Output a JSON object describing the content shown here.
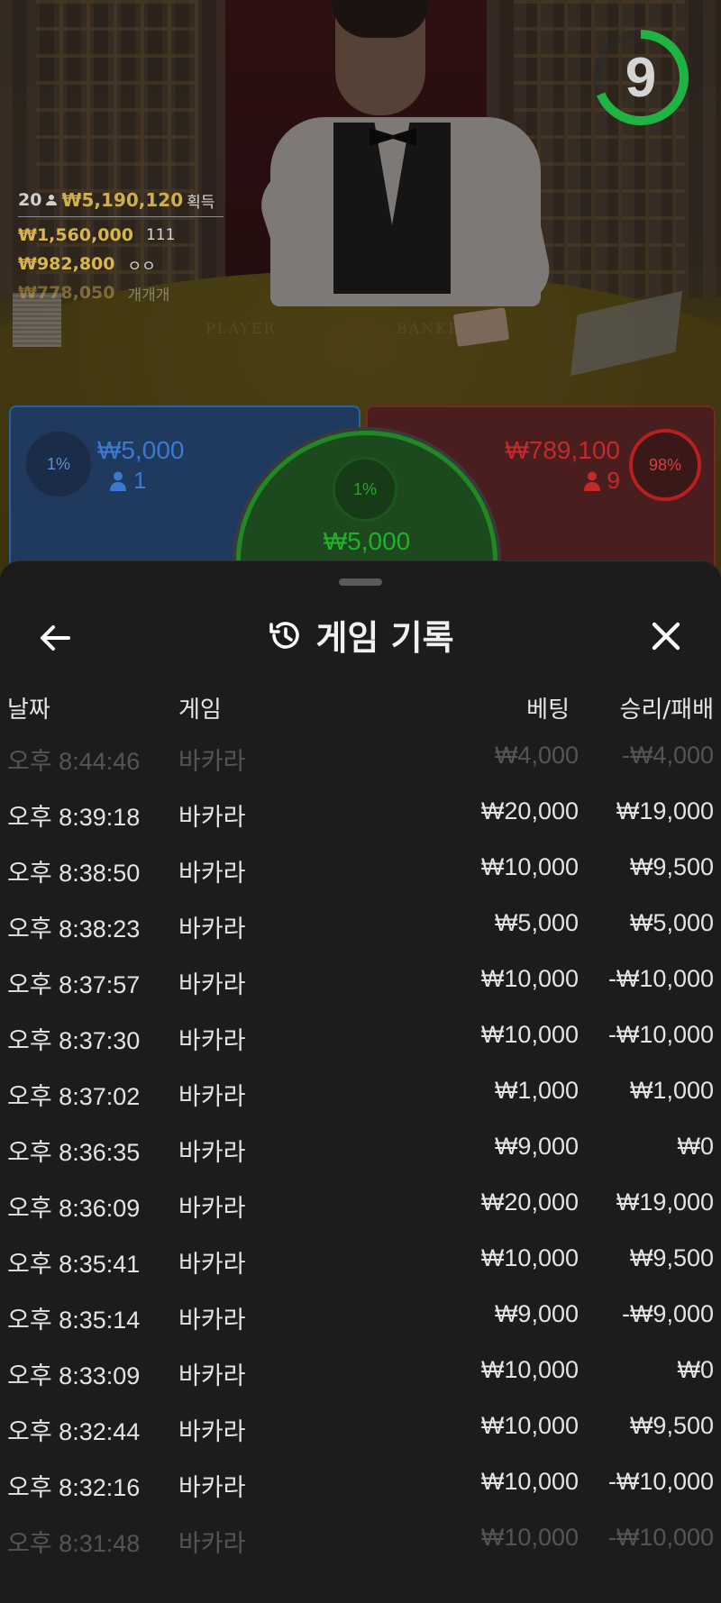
{
  "live": {
    "timer": "9",
    "felt_left": "PLAYER",
    "felt_right": "BANKER",
    "stats": {
      "player_count": "20",
      "total_won": "₩5,190,120",
      "won_label": "획득",
      "winners": [
        {
          "amount": "₩1,560,000",
          "name": "111"
        },
        {
          "amount": "₩982,800",
          "name": "ㅇㅇ"
        },
        {
          "amount": "₩778,050",
          "name": "개개개"
        }
      ]
    },
    "player_bet": {
      "percent": "1%",
      "amount": "₩5,000",
      "players": "1"
    },
    "banker_bet": {
      "percent": "98%",
      "amount": "₩789,100",
      "players": "9"
    },
    "tie_bet": {
      "percent": "1%",
      "amount": "₩5,000"
    },
    "colors": {
      "player": "#3c7ad0",
      "banker": "#c42a2a",
      "tie": "#21b02a",
      "timer_ring": "#1fb343"
    }
  },
  "sheet": {
    "title": "게임 기록",
    "title_icon": "history-icon",
    "back_icon": "arrow-left-icon",
    "close_icon": "close-icon",
    "columns": {
      "date": "날짜",
      "game": "게임",
      "bet": "베팅",
      "win_loss": "승리/패배"
    },
    "rows": [
      {
        "time": "오후 8:44:46",
        "game": "바카라",
        "bet": "₩4,000",
        "result": "-₩4,000"
      },
      {
        "time": "오후 8:39:18",
        "game": "바카라",
        "bet": "₩20,000",
        "result": "₩19,000"
      },
      {
        "time": "오후 8:38:50",
        "game": "바카라",
        "bet": "₩10,000",
        "result": "₩9,500"
      },
      {
        "time": "오후 8:38:23",
        "game": "바카라",
        "bet": "₩5,000",
        "result": "₩5,000"
      },
      {
        "time": "오후 8:37:57",
        "game": "바카라",
        "bet": "₩10,000",
        "result": "-₩10,000"
      },
      {
        "time": "오후 8:37:30",
        "game": "바카라",
        "bet": "₩10,000",
        "result": "-₩10,000"
      },
      {
        "time": "오후 8:37:02",
        "game": "바카라",
        "bet": "₩1,000",
        "result": "₩1,000"
      },
      {
        "time": "오후 8:36:35",
        "game": "바카라",
        "bet": "₩9,000",
        "result": "₩0"
      },
      {
        "time": "오후 8:36:09",
        "game": "바카라",
        "bet": "₩20,000",
        "result": "₩19,000"
      },
      {
        "time": "오후 8:35:41",
        "game": "바카라",
        "bet": "₩10,000",
        "result": "₩9,500"
      },
      {
        "time": "오후 8:35:14",
        "game": "바카라",
        "bet": "₩9,000",
        "result": "-₩9,000"
      },
      {
        "time": "오후 8:33:09",
        "game": "바카라",
        "bet": "₩10,000",
        "result": "₩0"
      },
      {
        "time": "오후 8:32:44",
        "game": "바카라",
        "bet": "₩10,000",
        "result": "₩9,500"
      },
      {
        "time": "오후 8:32:16",
        "game": "바카라",
        "bet": "₩10,000",
        "result": "-₩10,000"
      },
      {
        "time": "오후 8:31:48",
        "game": "바카라",
        "bet": "₩10,000",
        "result": "-₩10,000"
      }
    ]
  }
}
